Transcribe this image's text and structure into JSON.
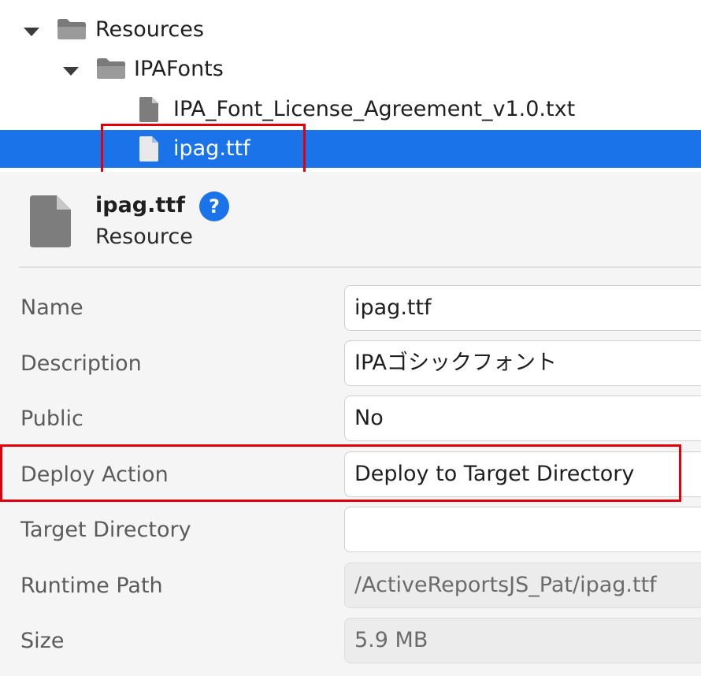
{
  "tree": {
    "items": [
      {
        "label": "Resources",
        "kind": "folder",
        "expanded": true,
        "selected": false
      },
      {
        "label": "IPAFonts",
        "kind": "folder",
        "expanded": true,
        "selected": false
      },
      {
        "label": "IPA_Font_License_Agreement_v1.0.txt",
        "kind": "file",
        "selected": false
      },
      {
        "label": "ipag.ttf",
        "kind": "file",
        "selected": true
      }
    ]
  },
  "details": {
    "name": "ipag.ttf",
    "type": "Resource",
    "help_glyph": "?"
  },
  "properties": [
    {
      "label": "Name",
      "value": "ipag.ttf",
      "readonly": false
    },
    {
      "label": "Description",
      "value": "IPAゴシックフォント",
      "readonly": false
    },
    {
      "label": "Public",
      "value": "No",
      "readonly": false
    },
    {
      "label": "Deploy Action",
      "value": "Deploy to Target Directory",
      "readonly": false
    },
    {
      "label": "Target Directory",
      "value": "",
      "readonly": false
    },
    {
      "label": "Runtime Path",
      "value": "/ActiveReportsJS_Pat/ipag.ttf",
      "readonly": true
    },
    {
      "label": "Size",
      "value": "5.9 MB",
      "readonly": true
    }
  ],
  "icons": {
    "folder": "folder-icon",
    "file": "file-icon",
    "expand": "caret-down-icon",
    "help": "help-icon"
  },
  "colors": {
    "selection": "#1a73e8",
    "highlight_box": "#e3000b",
    "panel_bg": "#f5f5f5",
    "label_text": "#5b5b5b"
  }
}
